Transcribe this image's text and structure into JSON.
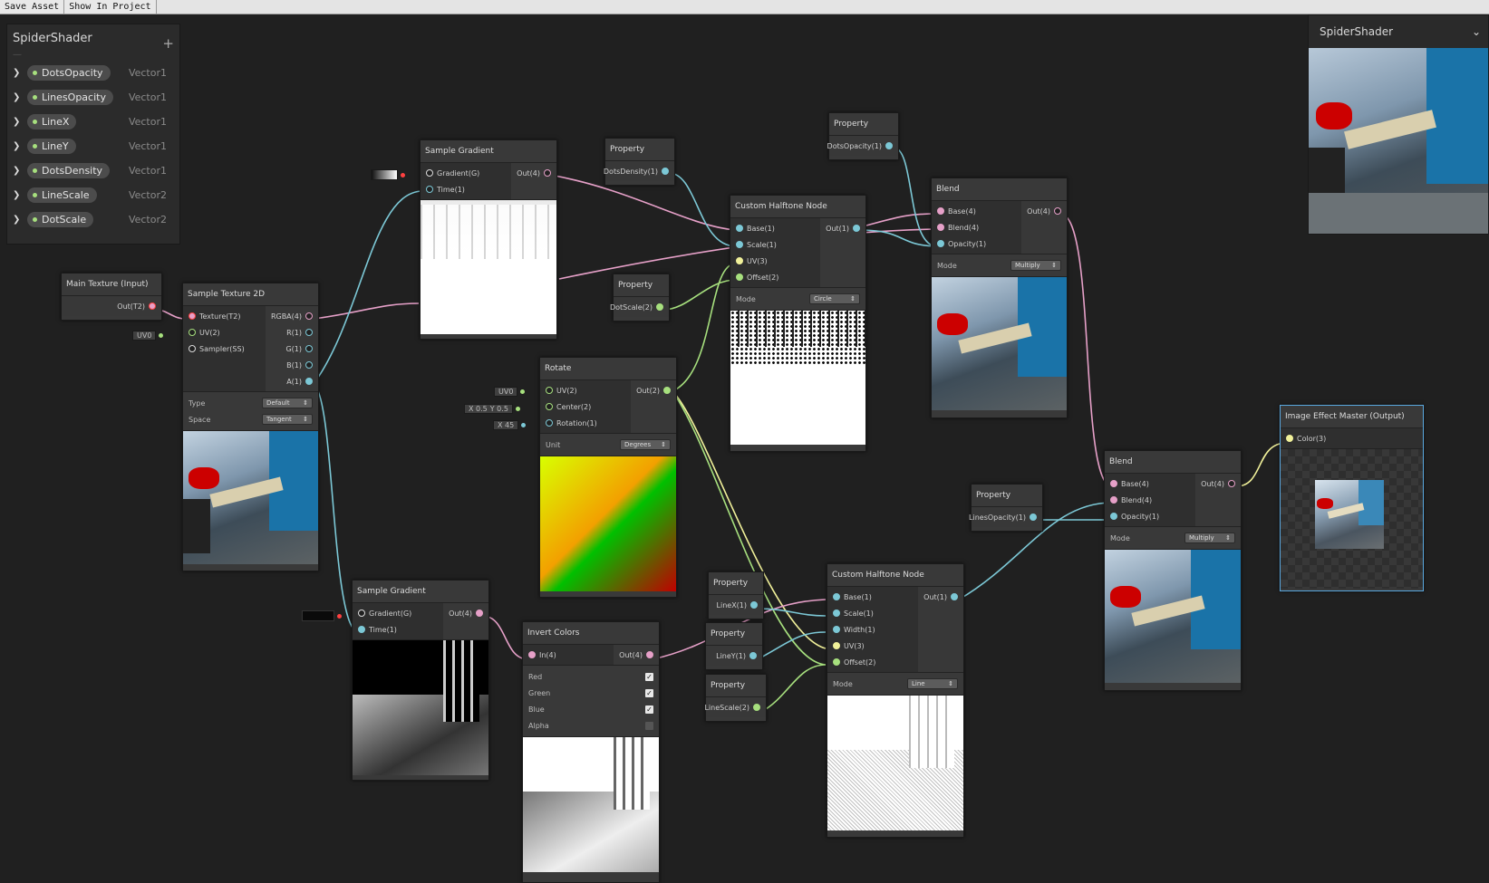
{
  "toolbar": {
    "save_asset": "Save Asset",
    "show_in_project": "Show In Project"
  },
  "blackboard": {
    "title": "SpiderShader",
    "sub": "—",
    "add": "+",
    "properties": [
      {
        "name": "DotsOpacity",
        "type": "Vector1"
      },
      {
        "name": "LinesOpacity",
        "type": "Vector1"
      },
      {
        "name": "LineX",
        "type": "Vector1"
      },
      {
        "name": "LineY",
        "type": "Vector1"
      },
      {
        "name": "DotsDensity",
        "type": "Vector1"
      },
      {
        "name": "LineScale",
        "type": "Vector2"
      },
      {
        "name": "DotScale",
        "type": "Vector2"
      }
    ]
  },
  "main_preview": {
    "title": "SpiderShader",
    "toggle": "⌄"
  },
  "nodes": {
    "main_texture": {
      "title": "Main Texture (Input)",
      "out": "Out(T2)"
    },
    "sample_tex": {
      "title": "Sample Texture 2D",
      "in": [
        "Texture(T2)",
        "UV(2)",
        "Sampler(SS)"
      ],
      "out": [
        "RGBA(4)",
        "R(1)",
        "G(1)",
        "B(1)",
        "A(1)"
      ],
      "type_label": "Type",
      "type_val": "Default",
      "space_label": "Space",
      "space_val": "Tangent",
      "uv_pin": "UV0"
    },
    "sample_grad1": {
      "title": "Sample Gradient",
      "in": [
        "Gradient(G)",
        "Time(1)"
      ],
      "out": "Out(4)"
    },
    "prop_dotsdensity": {
      "title": "Property",
      "out": "DotsDensity(1)"
    },
    "prop_dotsopacity": {
      "title": "Property",
      "out": "DotsOpacity(1)"
    },
    "prop_dotscale": {
      "title": "Property",
      "out": "DotScale(2)"
    },
    "halftone1": {
      "title": "Custom Halftone Node",
      "in": [
        "Base(1)",
        "Scale(1)",
        "UV(3)",
        "Offset(2)"
      ],
      "out": "Out(1)",
      "mode_label": "Mode",
      "mode_val": "Circle"
    },
    "blend1": {
      "title": "Blend",
      "in": [
        "Base(4)",
        "Blend(4)",
        "Opacity(1)"
      ],
      "out": "Out(4)",
      "mode_label": "Mode",
      "mode_val": "Multiply"
    },
    "rotate": {
      "title": "Rotate",
      "in": [
        "UV(2)",
        "Center(2)",
        "Rotation(1)"
      ],
      "out": "Out(2)",
      "unit_label": "Unit",
      "unit_val": "Degrees",
      "uv_pin": "UV0",
      "center_x": "X 0.5",
      "center_y": "Y 0.5",
      "rot_x": "X 45"
    },
    "sample_grad2": {
      "title": "Sample Gradient",
      "in": [
        "Gradient(G)",
        "Time(1)"
      ],
      "out": "Out(4)"
    },
    "invert": {
      "title": "Invert Colors",
      "in": "In(4)",
      "out": "Out(4)",
      "opts": [
        {
          "label": "Red",
          "mark": "✓"
        },
        {
          "label": "Green",
          "mark": "✓"
        },
        {
          "label": "Blue",
          "mark": "✓"
        },
        {
          "label": "Alpha",
          "mark": ""
        }
      ]
    },
    "prop_linex": {
      "title": "Property",
      "out": "LineX(1)"
    },
    "prop_liney": {
      "title": "Property",
      "out": "LineY(1)"
    },
    "prop_linescale": {
      "title": "Property",
      "out": "LineScale(2)"
    },
    "halftone2": {
      "title": "Custom Halftone Node",
      "in": [
        "Base(1)",
        "Scale(1)",
        "Width(1)",
        "UV(3)",
        "Offset(2)"
      ],
      "out": "Out(1)",
      "mode_label": "Mode",
      "mode_val": "Line"
    },
    "prop_linesopacity": {
      "title": "Property",
      "out": "LinesOpacity(1)"
    },
    "blend2": {
      "title": "Blend",
      "in": [
        "Base(4)",
        "Blend(4)",
        "Opacity(1)"
      ],
      "out": "Out(4)",
      "mode_label": "Mode",
      "mode_val": "Multiply"
    },
    "master": {
      "title": "Image Effect Master (Output)",
      "in": "Color(3)"
    }
  }
}
